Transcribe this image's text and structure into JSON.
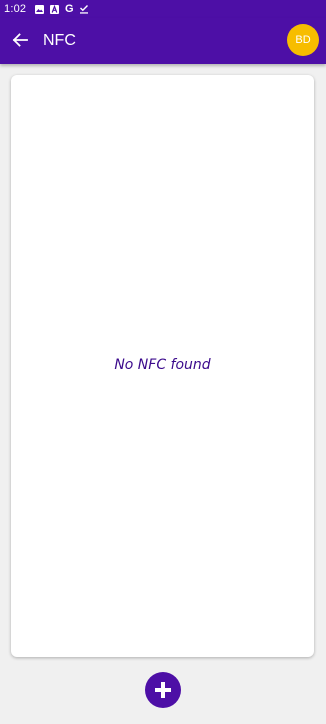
{
  "status_bar": {
    "time": "1:02",
    "icons": [
      "image-icon",
      "a-box-icon",
      "google-g-icon",
      "download-check-icon"
    ],
    "g_letter": "G"
  },
  "app_bar": {
    "title": "NFC",
    "back_icon": "arrow-left-icon",
    "avatar_initials": "BD",
    "avatar_color": "#f7bd00"
  },
  "main": {
    "empty_message": "No NFC found"
  },
  "fab": {
    "icon": "plus-icon"
  },
  "colors": {
    "primary": "#4d0fa6",
    "background": "#f0f0f0",
    "card": "#ffffff",
    "empty_text": "#3b0a8c"
  }
}
